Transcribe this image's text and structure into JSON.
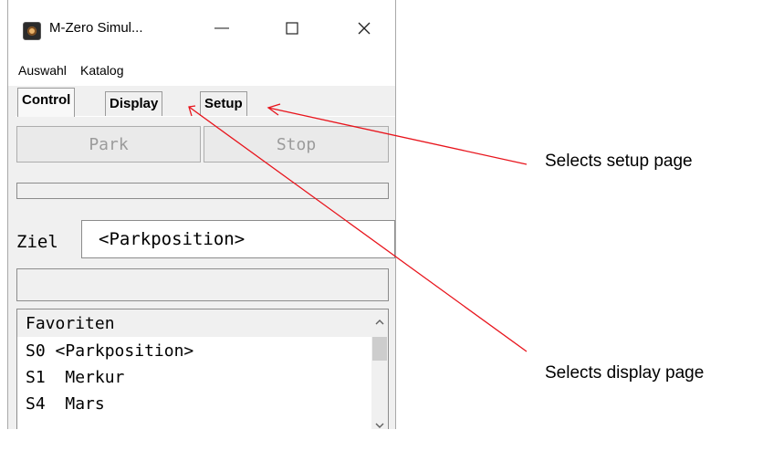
{
  "window": {
    "title": "M-Zero Simul...",
    "minimize_glyph": "—",
    "maximize_glyph": "☐",
    "close_glyph": "✕"
  },
  "menu": {
    "items": [
      "Auswahl",
      "Katalog"
    ]
  },
  "tabs": [
    {
      "label": "Control",
      "active": true
    },
    {
      "label": "Display",
      "active": false
    },
    {
      "label": "Setup",
      "active": false
    }
  ],
  "control": {
    "park_label": "Park",
    "stop_label": "Stop",
    "target_label": "Ziel",
    "target_value": "<Parkposition>"
  },
  "list": {
    "header": "Favoriten",
    "items": [
      {
        "code": "S0",
        "name": "<Parkposition>"
      },
      {
        "code": "S1",
        "name": "Merkur"
      },
      {
        "code": "S4",
        "name": "Mars"
      }
    ]
  },
  "annotations": {
    "setup": "Selects setup page",
    "display": "Selects display page"
  },
  "colors": {
    "annotation_arrow": "#e8141c"
  }
}
